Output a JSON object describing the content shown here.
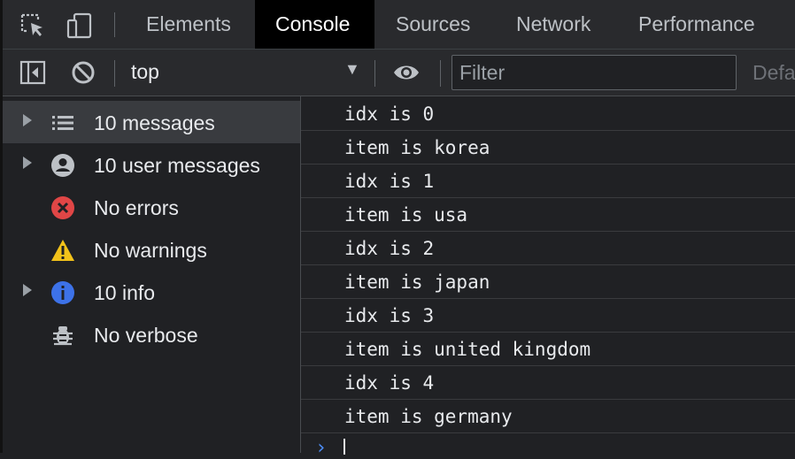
{
  "tabs": [
    {
      "label": "Elements",
      "active": false
    },
    {
      "label": "Console",
      "active": true
    },
    {
      "label": "Sources",
      "active": false
    },
    {
      "label": "Network",
      "active": false
    },
    {
      "label": "Performance",
      "active": false
    }
  ],
  "toolbar_icons": [
    "inspect-element-icon",
    "device-toolbar-icon"
  ],
  "toolbar": {
    "context": "top",
    "filter_placeholder": "Filter",
    "levels_label": "Defa"
  },
  "sidebar": {
    "items": [
      {
        "label": "10 messages",
        "icon": "list-icon",
        "expandable": true,
        "selected": true
      },
      {
        "label": "10 user messages",
        "icon": "user-icon",
        "expandable": true,
        "selected": false
      },
      {
        "label": "No errors",
        "icon": "error-icon",
        "expandable": false,
        "selected": false
      },
      {
        "label": "No warnings",
        "icon": "warning-icon",
        "expandable": false,
        "selected": false
      },
      {
        "label": "10 info",
        "icon": "info-icon",
        "expandable": true,
        "selected": false
      },
      {
        "label": "No verbose",
        "icon": "bug-icon",
        "expandable": false,
        "selected": false
      }
    ]
  },
  "console": {
    "messages": [
      "idx is 0",
      "item is korea",
      "idx is 1",
      "item is usa",
      "idx is 2",
      "item is japan",
      "idx is 3",
      "item is united kingdom",
      "idx is 4",
      "item is germany"
    ],
    "prompt_symbol": "›"
  },
  "colors": {
    "background": "#202124",
    "active_tab_bg": "#000000",
    "selected_sidebar_bg": "#393b3f",
    "error_red": "#e04646",
    "warning_yellow": "#f2c21a",
    "info_blue": "#3d72e8",
    "prompt_blue": "#4d8ef7"
  }
}
